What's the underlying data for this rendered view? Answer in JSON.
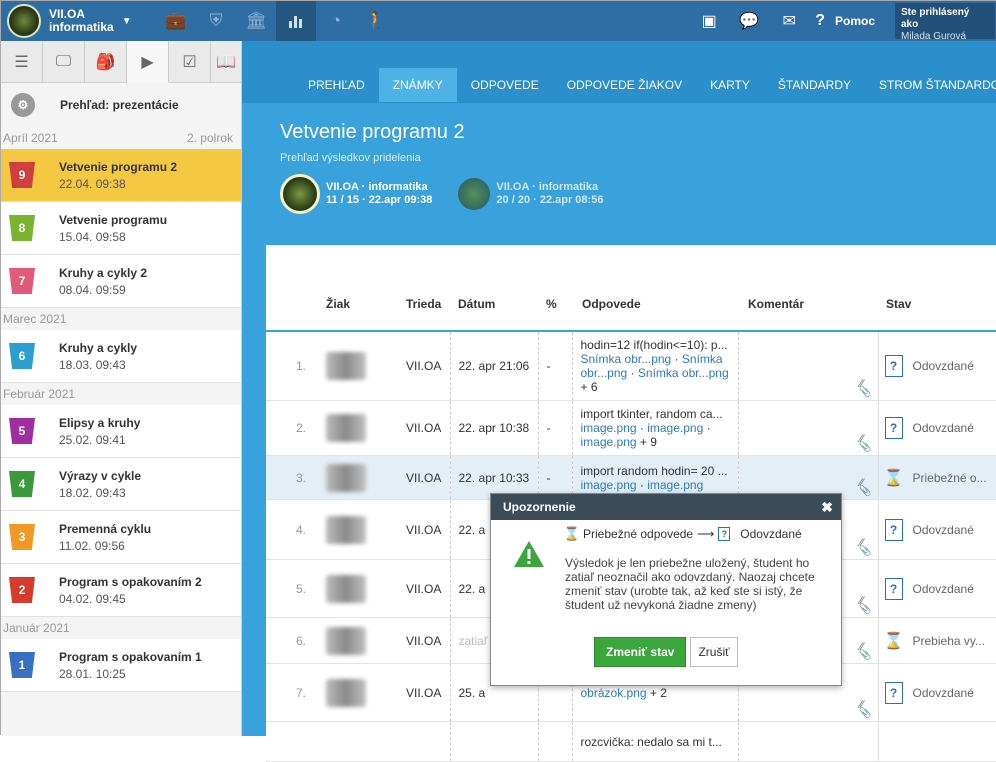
{
  "topbar": {
    "class_line1": "VII.OA",
    "class_line2": "informatika",
    "icons": [
      "briefcase-icon",
      "shield-icon",
      "bank-icon",
      "chart-icon",
      "trend-icon",
      "walking-icon"
    ],
    "right_icons": [
      "presentation-icon",
      "chat-icon",
      "mail-icon"
    ],
    "help": "Pomoc",
    "logged_label": "Ste prihlásený ako",
    "logged_user": "Milada Gurová"
  },
  "sidebar": {
    "header": "Prehľad: prezentácie",
    "groups": [
      {
        "month": "Apríl 2021",
        "note": "2. polrok",
        "items": [
          {
            "num": "9",
            "color": "#cf3f3f",
            "title": "Vetvenie programu 2",
            "date": "22.04. 09:38"
          },
          {
            "num": "8",
            "color": "#7ab32e",
            "title": "Vetvenie programu",
            "date": "15.04. 09:58"
          },
          {
            "num": "7",
            "color": "#e05a7a",
            "title": "Kruhy a cykly 2",
            "date": "08.04. 09:59"
          }
        ]
      },
      {
        "month": "Marec 2021",
        "note": "",
        "items": [
          {
            "num": "6",
            "color": "#2a9fd0",
            "title": "Kruhy a cykly",
            "date": "18.03. 09:43"
          }
        ]
      },
      {
        "month": "Február 2021",
        "note": "",
        "items": [
          {
            "num": "5",
            "color": "#a02ea0",
            "title": "Elipsy a kruhy",
            "date": "25.02. 09:41"
          },
          {
            "num": "4",
            "color": "#3a9a3a",
            "title": "Výrazy v cykle",
            "date": "18.02. 09:43"
          },
          {
            "num": "3",
            "color": "#f09a25",
            "title": "Premenná cyklu",
            "date": "11.02. 09:56"
          },
          {
            "num": "2",
            "color": "#d63a2a",
            "title": "Program s opakovaním 2",
            "date": "04.02. 09:45"
          }
        ]
      },
      {
        "month": "Január 2021",
        "note": "",
        "items": [
          {
            "num": "1",
            "color": "#3a6fc4",
            "title": "Program s opakovaním 1",
            "date": "28.01. 10:25"
          }
        ]
      }
    ]
  },
  "nav": {
    "tabs": [
      "PREHĽAD",
      "ZNÁMKY",
      "ODPOVEDE",
      "ODPOVEDE ŽIAKOV",
      "KARTY",
      "ŠTANDARDY",
      "STROM ŠTANDARDOV"
    ]
  },
  "header": {
    "title": "Vetvenie programu 2",
    "subtitle": "Prehľad výsledkov pridelenia",
    "assignments": [
      {
        "name": "VII.OA · informatika",
        "detail": "11 / 15 · 22.apr 09:38"
      },
      {
        "name": "VII.OA · informatika",
        "detail": "20 / 20 · 22.apr 08:56"
      }
    ]
  },
  "table": {
    "headers": [
      "Žiak",
      "Trieda",
      "Dátum",
      "%",
      "Odpovede",
      "Komentár",
      "Stav"
    ],
    "rows": [
      {
        "n": "1.",
        "cls": "VII.OA",
        "date": "22. apr 21:06",
        "pct": "-",
        "text": "hodin=12 if(hodin<=10): p...",
        "links": [
          "Snímka obr...png",
          "Snímka obr...png",
          "Snímka obr...png"
        ],
        "more": "+ 6",
        "status": "Odovzdané",
        "icon": "submitted"
      },
      {
        "n": "2.",
        "cls": "VII.OA",
        "date": "22. apr 10:38",
        "pct": "-",
        "text": "import tkinter, random ca...",
        "links": [
          "image.png",
          "image.png",
          "image.png"
        ],
        "more": "+ 9",
        "status": "Odovzdané",
        "icon": "submitted"
      },
      {
        "n": "3.",
        "cls": "VII.OA",
        "date": "22. apr 10:33",
        "pct": "-",
        "text": "import random hodin= 20 ...",
        "links": [
          "image.png",
          "image.png"
        ],
        "more": "",
        "status": "Priebežné o...",
        "icon": "progress"
      },
      {
        "n": "4.",
        "cls": "VII.OA",
        "date": "22. a",
        "pct": "",
        "text": "",
        "links": [],
        "more": "",
        "status": "Odovzdané",
        "icon": "submitted"
      },
      {
        "n": "5.",
        "cls": "VII.OA",
        "date": "22. a",
        "pct": "",
        "text": "",
        "links": [],
        "more": "",
        "status": "Odovzdané",
        "icon": "submitted"
      },
      {
        "n": "6.",
        "cls": "VII.OA",
        "date": "zatiaľ",
        "pct": "",
        "text": "",
        "links": [],
        "more": "",
        "status": "Prebieha vy...",
        "icon": "running"
      },
      {
        "n": "7.",
        "cls": "VII.OA",
        "date": "25. a",
        "pct": "",
        "text": "",
        "links": [
          "obrázok.png"
        ],
        "more": "+ 2",
        "status": "Odovzdané",
        "icon": "submitted"
      },
      {
        "n": "",
        "cls": "",
        "date": "",
        "pct": "",
        "text": "rozcvička: nedalo sa mi t...",
        "links": [],
        "more": "",
        "status": "",
        "icon": ""
      }
    ]
  },
  "modal": {
    "title": "Upozornenie",
    "from": "Priebežné odpovede",
    "to": "Odovzdané",
    "message": "Výsledok je len priebežne uložený, študent ho zatiaľ neoznačil ako odovzdaný. Naozaj chcete zmeniť stav (urobte tak, až keď ste si istý, že študent už nevykoná žiadne zmeny)",
    "confirm": "Zmeniť stav",
    "cancel": "Zrušiť"
  }
}
